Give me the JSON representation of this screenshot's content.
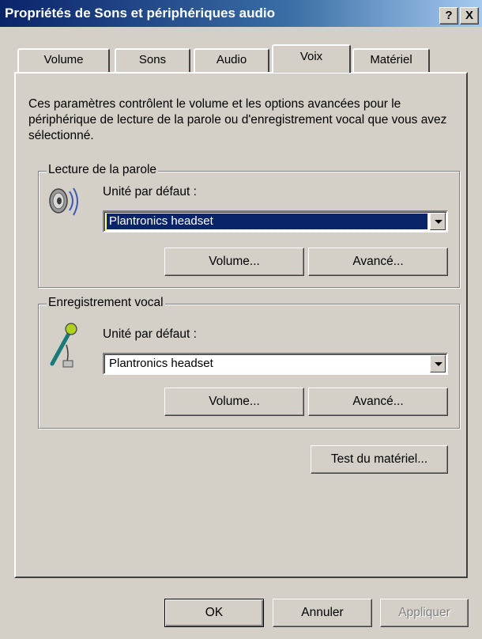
{
  "window": {
    "title": "Propriétés de Sons et périphériques audio",
    "help_label": "?",
    "close_label": "X"
  },
  "tabs": [
    {
      "label": "Volume",
      "active": false
    },
    {
      "label": "Sons",
      "active": false
    },
    {
      "label": "Audio",
      "active": false
    },
    {
      "label": "Voix",
      "active": true
    },
    {
      "label": "Matériel",
      "active": false
    }
  ],
  "voice": {
    "description": "Ces paramètres contrôlent le volume et les options avancées pour le périphérique de lecture de la parole ou d'enregistrement vocal que vous avez sélectionné.",
    "playback": {
      "group_title": "Lecture de la parole",
      "icon": "speaker-icon",
      "default_device_label": "Unité par défaut :",
      "device_value": "Plantronics headset",
      "volume_button": "Volume...",
      "advanced_button": "Avancé..."
    },
    "recording": {
      "group_title": "Enregistrement vocal",
      "icon": "microphone-icon",
      "default_device_label": "Unité par défaut :",
      "device_value": "Plantronics headset",
      "volume_button": "Volume...",
      "advanced_button": "Avancé..."
    },
    "test_hardware_button": "Test du matériel..."
  },
  "footer": {
    "ok_button": "OK",
    "cancel_button": "Annuler",
    "apply_button": "Appliquer",
    "apply_disabled": true
  },
  "colors": {
    "titlebar_start": "#0a246a",
    "titlebar_end": "#a6caf0",
    "face": "#d4d0c8",
    "selection": "#0a246a"
  }
}
